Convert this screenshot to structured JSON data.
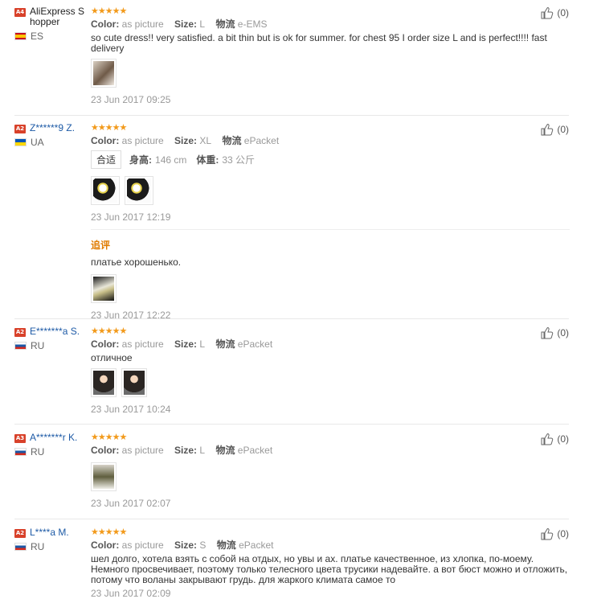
{
  "helpful_counts_label": "(0)",
  "reviews": [
    {
      "level": "A4",
      "user": "AliExpress Shopper",
      "country": "ES",
      "stars": "★★★★★",
      "color_label": "Color:",
      "color_value": "as picture",
      "size_label": "Size:",
      "size_value": "L",
      "logistics_label": "物流",
      "logistics_value": "e-EMS",
      "text": "so cute dress!! very satisfied. a bit thin but is ok for summer. for chest 95 I order size L and is perfect!!!! fast delivery",
      "date": "23 Jun 2017 09:25",
      "helpful": "(0)"
    },
    {
      "level": "A2",
      "user": "Z******9 Z.",
      "country": "UA",
      "stars": "★★★★★",
      "color_label": "Color:",
      "color_value": "as picture",
      "size_label": "Size:",
      "size_value": "XL",
      "logistics_label": "物流",
      "logistics_value": "ePacket",
      "fit_tag": "合适",
      "height_label": "身高:",
      "height_value": "146 cm",
      "weight_label": "体重:",
      "weight_value": "33 公斤",
      "date": "23 Jun 2017 12:19",
      "followup_title": "追评",
      "followup_text": "платье хорошенько.",
      "followup_date": "23 Jun 2017 12:22",
      "helpful": "(0)"
    },
    {
      "level": "A2",
      "user": "E*******a S.",
      "country": "RU",
      "stars": "★★★★★",
      "color_label": "Color:",
      "color_value": "as picture",
      "size_label": "Size:",
      "size_value": "L",
      "logistics_label": "物流",
      "logistics_value": "ePacket",
      "text": "отличное",
      "date": "23 Jun 2017 10:24",
      "helpful": "(0)"
    },
    {
      "level": "A3",
      "user": "A*******r K.",
      "country": "RU",
      "stars": "★★★★★",
      "color_label": "Color:",
      "color_value": "as picture",
      "size_label": "Size:",
      "size_value": "L",
      "logistics_label": "物流",
      "logistics_value": "ePacket",
      "date": "23 Jun 2017 02:07",
      "helpful": "(0)"
    },
    {
      "level": "A2",
      "user": "L****a M.",
      "country": "RU",
      "stars": "★★★★★",
      "color_label": "Color:",
      "color_value": "as picture",
      "size_label": "Size:",
      "size_value": "S",
      "logistics_label": "物流",
      "logistics_value": "ePacket",
      "text": "шел долго, хотела взять с собой на отдых, но увы и ах. платье качественное, из хлопка, по-моему. Немного просвечивает, поэтому только телесного цвета трусики надевайте. а вот бюст можно и отложить, потому что воланы закрывают грудь. для жаркого климата самое то",
      "date": "23 Jun 2017 02:09",
      "helpful": "(0)"
    }
  ],
  "colors": {
    "star": "#f29a1b",
    "level_badge": "#d8412a",
    "username_link": "#1d5aa6",
    "followup": "#e07b00"
  },
  "icons": {
    "helpful": "thumbs-up-icon",
    "level": "level-badge-icon"
  }
}
